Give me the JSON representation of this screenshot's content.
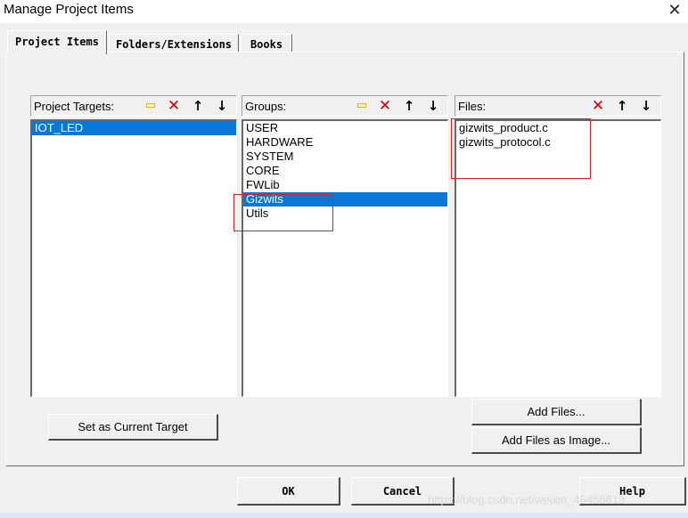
{
  "window": {
    "title": "Manage Project Items",
    "close_glyph": "✕"
  },
  "tabs": [
    {
      "label": "Project Items",
      "active": true
    },
    {
      "label": "Folders/Extensions",
      "active": false
    },
    {
      "label": "Books",
      "active": false
    }
  ],
  "panes": {
    "targets": {
      "label": "Project Targets:",
      "items": [
        "IOT_LED"
      ],
      "selected_index": 0
    },
    "groups": {
      "label": "Groups:",
      "items": [
        "USER",
        "HARDWARE",
        "SYSTEM",
        "CORE",
        "FWLib",
        "Gizwits",
        "Utils"
      ],
      "selected_index": 5
    },
    "files": {
      "label": "Files:",
      "items": [
        "gizwits_product.c",
        "gizwits_protocol.c"
      ]
    }
  },
  "icons": {
    "new": "new-item-icon",
    "delete": "delete-icon",
    "up": "move-up-icon",
    "down": "move-down-icon"
  },
  "buttons": {
    "set_current": "Set as Current Target",
    "add_files": "Add Files...",
    "add_files_image": "Add Files as Image...",
    "ok": "OK",
    "cancel": "Cancel",
    "help": "Help"
  },
  "watermark": "https://blog.csdn.net/weixin_46488613",
  "colors": {
    "selection": "#0a78d7",
    "annotation": "#e02020",
    "dialog_bg": "#f0f0f0"
  }
}
